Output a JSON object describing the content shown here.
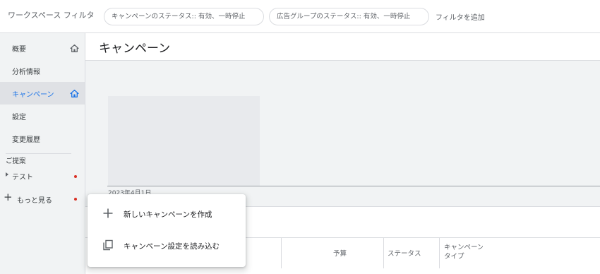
{
  "filter_bar": {
    "workspace_label": "ワークスペース フィルタ",
    "chips": [
      "キャンペーンのステータス:: 有効、一時停止",
      "広告グループのステータス:: 有効、一時停止"
    ],
    "add_filter": "フィルタを追加"
  },
  "sidebar": {
    "items": [
      {
        "label": "概要",
        "icon": "home-icon"
      },
      {
        "label": "分析情報"
      },
      {
        "label": "キャンペーン",
        "icon": "home-icon",
        "active": true
      },
      {
        "label": "設定"
      },
      {
        "label": "変更履歴"
      }
    ],
    "suggestions_heading": "ご提案",
    "suggestion_item": "テスト",
    "more": "もっと見る"
  },
  "main": {
    "title": "キャンペーン",
    "chart_date": "2023年4月1日",
    "table_headers": {
      "budget": "予算",
      "status": "ステータス",
      "type_line1": "キャンペーン",
      "type_line2": "タイプ"
    }
  },
  "popup": {
    "items": [
      {
        "label": "新しいキャンペーンを作成",
        "icon": "plus-icon"
      },
      {
        "label": "キャンペーン設定を読み込む",
        "icon": "copy-icon"
      }
    ]
  },
  "colors": {
    "accent": "#1a73e8",
    "notification_dot": "#d93025",
    "sidebar_bg": "#f1f3f4"
  }
}
